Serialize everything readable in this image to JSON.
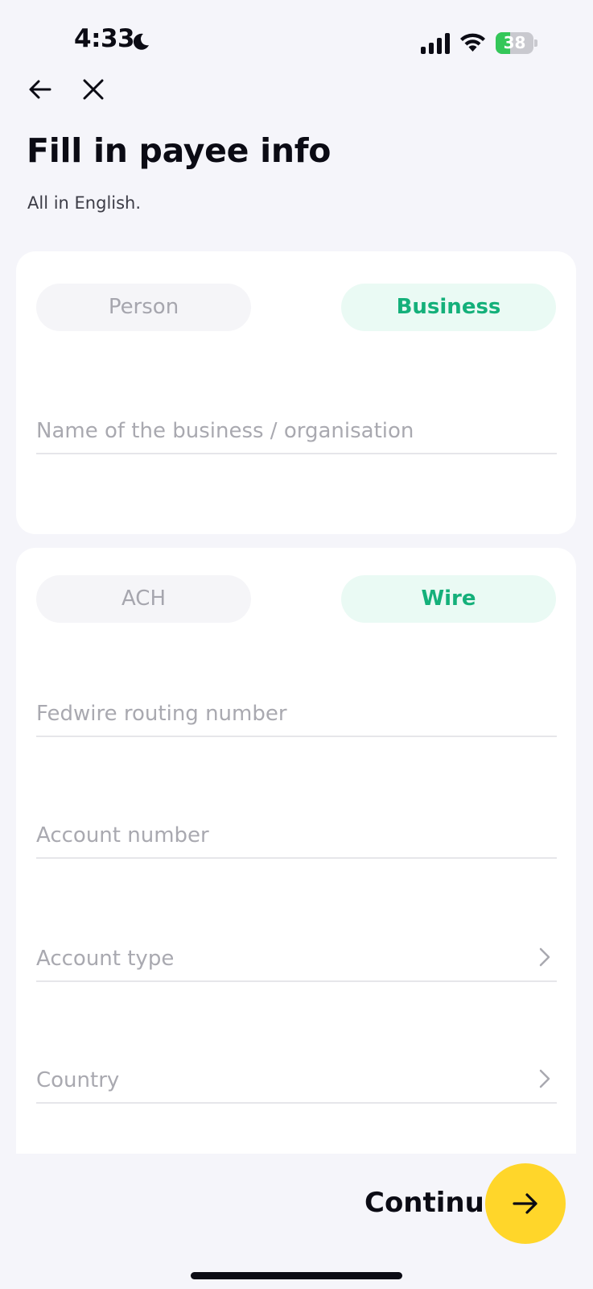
{
  "status_bar": {
    "time": "4:33",
    "battery_level": "38",
    "battery_fraction": 0.38
  },
  "header": {
    "title": "Fill in payee info",
    "subtitle": "All in English."
  },
  "payee_type": {
    "options": [
      "Person",
      "Business"
    ],
    "selected": "Business"
  },
  "payee_fields": {
    "business_name_placeholder": "Name of the business / organisation"
  },
  "transfer_method": {
    "options": [
      "ACH",
      "Wire"
    ],
    "selected": "Wire"
  },
  "bank_fields": {
    "routing_placeholder": "Fedwire routing number",
    "account_number_placeholder": "Account number",
    "account_type_placeholder": "Account type",
    "country_placeholder": "Country"
  },
  "footer": {
    "continue_label": "Continue"
  },
  "colors": {
    "accent_green": "#14b07a",
    "continue_yellow": "#ffd62a",
    "background": "#f5f5fa"
  }
}
